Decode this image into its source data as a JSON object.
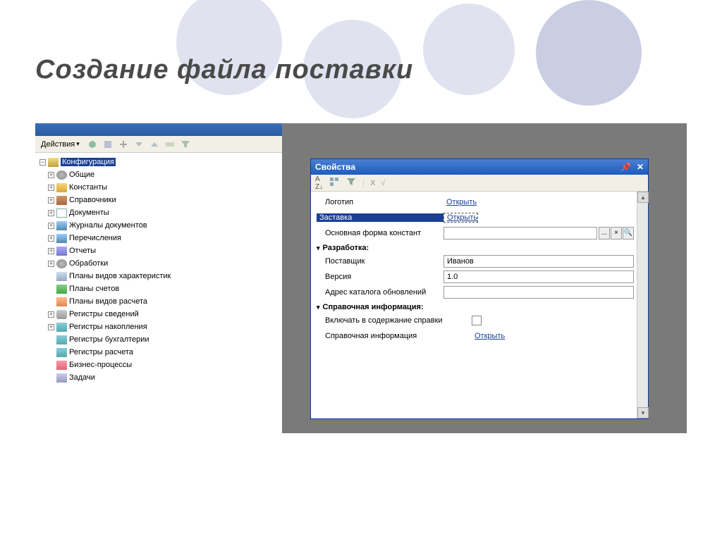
{
  "slide": {
    "title": "Создание файла поставки"
  },
  "configWindow": {
    "toolbar": {
      "actions": "Действия"
    },
    "tree": {
      "root": "Конфигурация",
      "items": [
        {
          "label": "Общие",
          "icon": "ico-gear",
          "expandable": true
        },
        {
          "label": "Константы",
          "icon": "ico-folder",
          "expandable": true
        },
        {
          "label": "Справочники",
          "icon": "ico-book",
          "expandable": true
        },
        {
          "label": "Документы",
          "icon": "ico-doc",
          "expandable": true
        },
        {
          "label": "Журналы документов",
          "icon": "ico-list",
          "expandable": true
        },
        {
          "label": "Перечисления",
          "icon": "ico-list",
          "expandable": true
        },
        {
          "label": "Отчеты",
          "icon": "ico-report",
          "expandable": true
        },
        {
          "label": "Обработки",
          "icon": "ico-gear",
          "expandable": true
        },
        {
          "label": "Планы видов характеристик",
          "icon": "ico-grid",
          "expandable": false
        },
        {
          "label": "Планы счетов",
          "icon": "ico-chart",
          "expandable": false
        },
        {
          "label": "Планы видов расчета",
          "icon": "ico-calc",
          "expandable": false
        },
        {
          "label": "Регистры сведений",
          "icon": "ico-db",
          "expandable": true
        },
        {
          "label": "Регистры накопления",
          "icon": "ico-reg",
          "expandable": true
        },
        {
          "label": "Регистры бухгалтерии",
          "icon": "ico-reg",
          "expandable": false
        },
        {
          "label": "Регистры расчета",
          "icon": "ico-reg",
          "expandable": false
        },
        {
          "label": "Бизнес-процессы",
          "icon": "ico-biz",
          "expandable": false
        },
        {
          "label": "Задачи",
          "icon": "ico-task",
          "expandable": false
        }
      ]
    }
  },
  "propsWindow": {
    "title": "Свойства",
    "rows": {
      "logo_label": "Логотип",
      "logo_link": "Открыть",
      "splash_label": "Заставка",
      "splash_link": "Открыть",
      "constform_label": "Основная форма констант",
      "section_dev": "Разработка:",
      "supplier_label": "Поставщик",
      "supplier_value": "Иванов",
      "version_label": "Версия",
      "version_value": "1.0",
      "update_label": "Адрес каталога обновлений",
      "update_value": "",
      "section_help": "Справочная информация:",
      "include_label": "Включать в содержание справки",
      "helpinfo_label": "Справочная информация",
      "helpinfo_link": "Открыть"
    }
  }
}
